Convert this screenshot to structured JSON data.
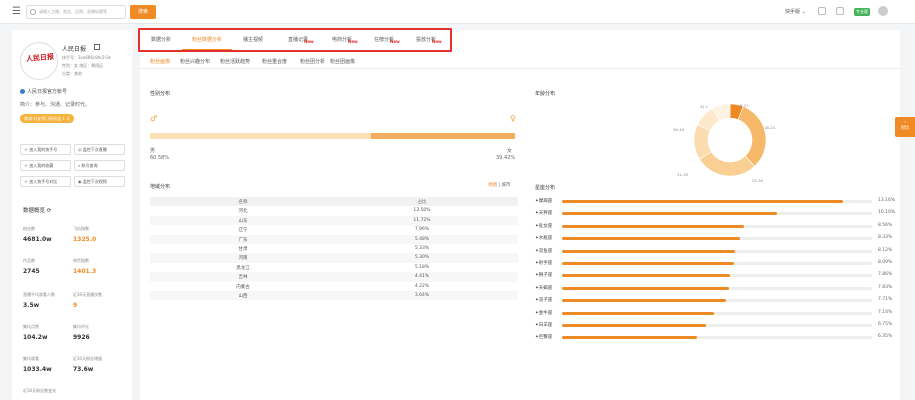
{
  "topbar": {
    "search_placeholder": "请输入主播、商品、品牌、直播标题等",
    "search_button": "搜索",
    "platform": "快手版",
    "pro_badge": "专业版"
  },
  "profile": {
    "logo_text": "人民日报",
    "name": "人民日报",
    "kuaishou_id": "快手号：3xa686c8hr2r3e",
    "gender_region": "性别：女   地区：朝阳区",
    "category": "分类：其他",
    "verify": "人民日报官方帐号",
    "intro": "简介：参与、沟通、记录时代。",
    "invite": "邀请·好友得订阅权益 1 天"
  },
  "actions": [
    {
      "label": "加入我的快手号"
    },
    {
      "label": "监控下次直播"
    },
    {
      "label": "加入我的收藏"
    },
    {
      "label": "帐号查询"
    },
    {
      "label": "加入快手号对比"
    },
    {
      "label": "监控下次视频"
    }
  ],
  "overview": {
    "title": "数据概览",
    "stats": [
      {
        "label": "粉丝数",
        "value": "4681.0w",
        "orange": false
      },
      {
        "label": "飞瓜指数",
        "value": "1325.0",
        "orange": true
      },
      {
        "label": "作品数",
        "value": "2745",
        "orange": false
      },
      {
        "label": "带货指数",
        "value": "1401.3",
        "orange": true
      },
      {
        "label": "直播平均观看人数",
        "value": "3.5w",
        "orange": false
      },
      {
        "label": "近30天直播次数",
        "value": "9",
        "orange": true
      },
      {
        "label": "集均点赞",
        "value": "104.2w",
        "orange": false
      },
      {
        "label": "集均评论",
        "value": "9926",
        "orange": false
      },
      {
        "label": "集均观看",
        "value": "1033.4w",
        "orange": false
      },
      {
        "label": "近30天粉丝增量",
        "value": "73.6w",
        "orange": false
      },
      {
        "label": "近30天粉丝数变化",
        "value": "",
        "orange": false
      }
    ]
  },
  "top_tabs": [
    {
      "label": "数据分析",
      "new": false,
      "active": false
    },
    {
      "label": "粉丝数据分析",
      "new": false,
      "active": true
    },
    {
      "label": "播主视频",
      "new": false,
      "active": false
    },
    {
      "label": "直播记录",
      "new": true,
      "active": false
    },
    {
      "label": "电商分析",
      "new": true,
      "active": false
    },
    {
      "label": "在榜分析",
      "new": true,
      "active": false
    },
    {
      "label": "投放分析",
      "new": true,
      "active": false
    }
  ],
  "new_label": "New",
  "sub_tabs": [
    {
      "label": "粉丝画像",
      "active": true
    },
    {
      "label": "粉丝兴趣分布",
      "active": false
    },
    {
      "label": "粉丝活跃趋势",
      "active": false
    },
    {
      "label": "粉丝重合度",
      "active": false
    },
    {
      "label": "粉丝团分析",
      "active": false
    },
    {
      "label": "粉丝团画像",
      "active": false
    }
  ],
  "gender": {
    "title": "性别分布",
    "male_label": "男",
    "male_pct": "60.58%",
    "male_value": 60.58,
    "female_label": "女",
    "female_pct": "39.42%",
    "female_value": 39.42,
    "male_color": "#fbe0b3",
    "female_color": "#f2ac5c"
  },
  "region": {
    "title": "地域分布",
    "toggle_map": "地图",
    "toggle_sep": "|",
    "toggle_city": "城市",
    "col_name": "名称",
    "col_pct": "占比",
    "rows": [
      {
        "name": "河北",
        "pct": "13.50%"
      },
      {
        "name": "山东",
        "pct": "11.72%"
      },
      {
        "name": "辽宁",
        "pct": "7.96%"
      },
      {
        "name": "广东",
        "pct": "5.48%"
      },
      {
        "name": "甘肃",
        "pct": "5.33%"
      },
      {
        "name": "河南",
        "pct": "5.30%"
      },
      {
        "name": "黑龙江",
        "pct": "5.18%"
      },
      {
        "name": "吉林",
        "pct": "4.41%"
      },
      {
        "name": "内蒙古",
        "pct": "4.22%"
      },
      {
        "name": "山西",
        "pct": "3.64%"
      }
    ]
  },
  "age": {
    "title": "年龄分布",
    "labels": [
      "6-17",
      "18-24",
      "25-30",
      "31-35",
      "36-40",
      "41+"
    ],
    "segments": [
      {
        "value": 6,
        "color": "#ee8a24"
      },
      {
        "value": 32,
        "color": "#f5b969"
      },
      {
        "value": 28,
        "color": "#f9cf93"
      },
      {
        "value": 16,
        "color": "#fbdcae"
      },
      {
        "value": 10,
        "color": "#fde8cb"
      },
      {
        "value": 8,
        "color": "#fef2e1"
      }
    ]
  },
  "zodiac": {
    "title": "星座分布",
    "items": [
      {
        "name": "摩羯座",
        "pct": "13.16%",
        "value": 13.16
      },
      {
        "name": "天秤座",
        "pct": "10.10%",
        "value": 10.1
      },
      {
        "name": "处女座",
        "pct": "8.56%",
        "value": 8.56
      },
      {
        "name": "水瓶座",
        "pct": "8.33%",
        "value": 8.33
      },
      {
        "name": "双鱼座",
        "pct": "8.12%",
        "value": 8.12
      },
      {
        "name": "射手座",
        "pct": "8.09%",
        "value": 8.09
      },
      {
        "name": "狮子座",
        "pct": "7.86%",
        "value": 7.86
      },
      {
        "name": "天蝎座",
        "pct": "7.83%",
        "value": 7.83
      },
      {
        "name": "双子座",
        "pct": "7.71%",
        "value": 7.71
      },
      {
        "name": "金牛座",
        "pct": "7.14%",
        "value": 7.14
      },
      {
        "name": "白羊座",
        "pct": "6.75%",
        "value": 6.75
      },
      {
        "name": "巨蟹座",
        "pct": "6.35%",
        "value": 6.35
      }
    ]
  },
  "side_tab": "对比"
}
